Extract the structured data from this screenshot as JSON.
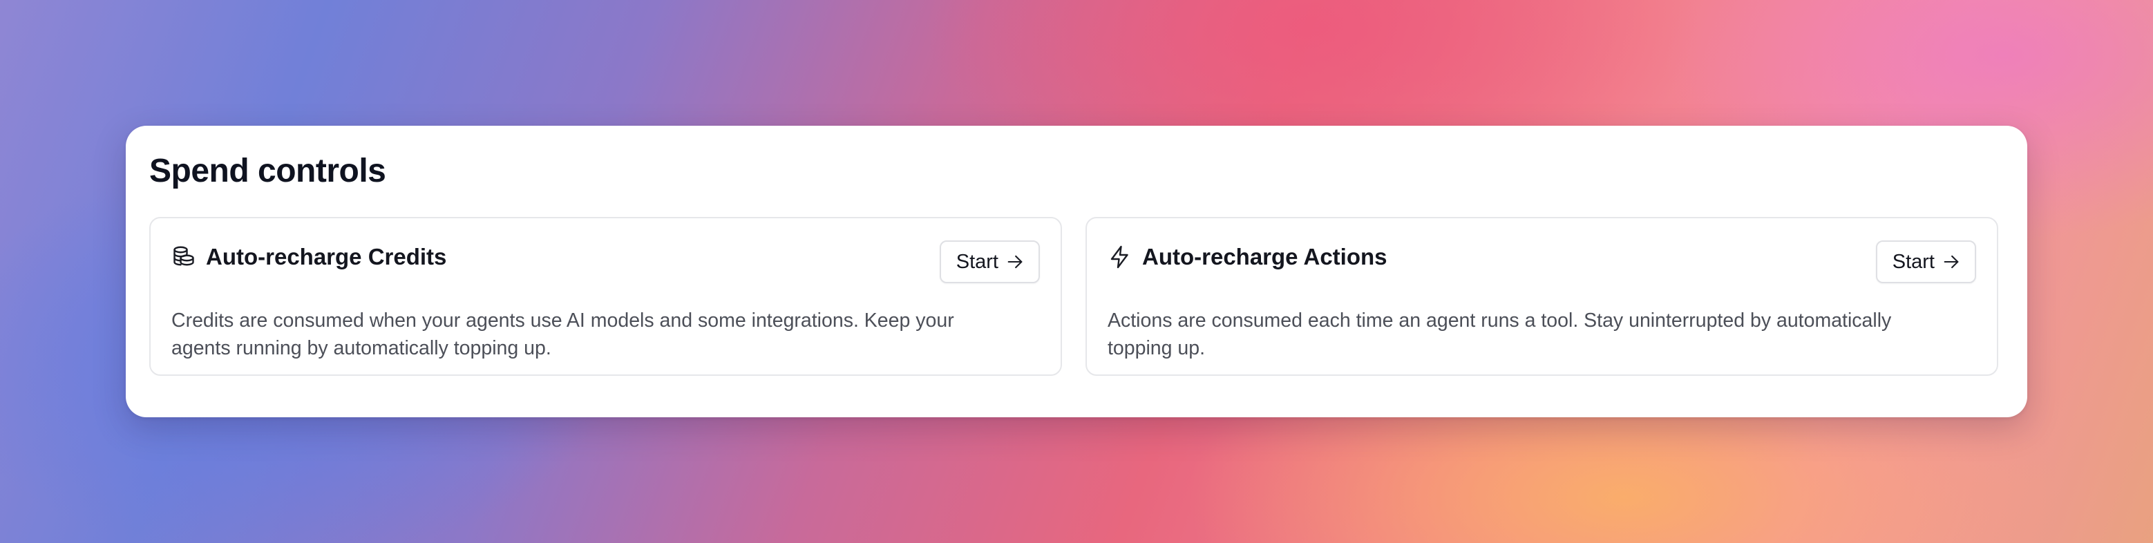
{
  "panel": {
    "title": "Spend controls"
  },
  "cards": [
    {
      "icon": "coins-stack-icon",
      "title": "Auto-recharge Credits",
      "button_label": "Start",
      "description": "Credits are consumed when your agents use AI models and some integrations. Keep your agents running by automatically topping up."
    },
    {
      "icon": "lightning-bolt-icon",
      "title": "Auto-recharge Actions",
      "button_label": "Start",
      "description": "Actions are consumed each time an agent runs a tool. Stay uninterrupted by automatically topping up."
    }
  ],
  "colors": {
    "card_border": "#e6e7ea",
    "title_text": "#0f1320",
    "body_text": "#4c4f58"
  }
}
